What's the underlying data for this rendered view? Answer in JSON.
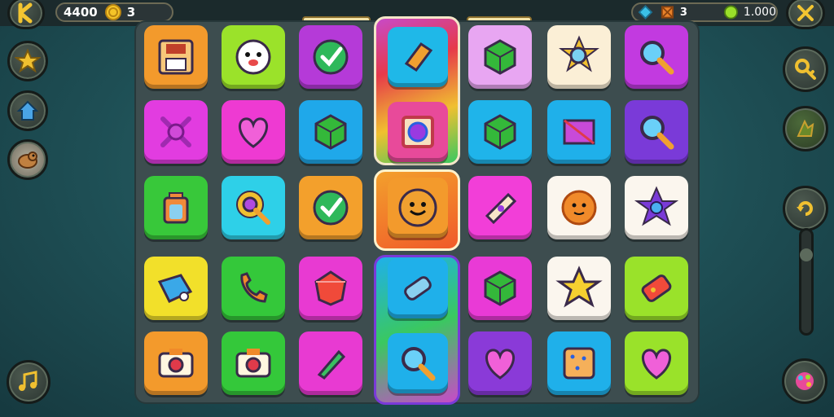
{
  "hud": {
    "back_icon": "back-icon",
    "moves_value": "4400",
    "coins_value": "3",
    "gems_value": "3",
    "gold_value": "1.000",
    "settings_icon": "crossed-tools-icon"
  },
  "left_panel": {
    "powerups": [
      {
        "name": "star-powerup",
        "icon": "star-icon",
        "color": "#f0c030"
      },
      {
        "name": "house-powerup",
        "icon": "house-icon",
        "color": "#4aa4e6"
      },
      {
        "name": "beast-powerup",
        "icon": "beast-icon",
        "color": "#c08040"
      }
    ],
    "music_icon": "music-note-icon"
  },
  "right_panel": {
    "buttons": [
      {
        "name": "key-button",
        "icon": "key-icon"
      },
      {
        "name": "hint-button",
        "icon": "hint-icon"
      },
      {
        "name": "refresh-button",
        "icon": "refresh-icon"
      }
    ],
    "slider_level": 0.2,
    "palette_icon": "palette-icon"
  },
  "board": {
    "rows": [
      [
        {
          "bg": "#f39a2c",
          "icon": "floppy-icon"
        },
        {
          "bg": "#9be22a",
          "icon": "face-icon"
        },
        {
          "bg": "#b53ad8",
          "icon": "check-icon"
        },
        {
          "bg": "#1fb8e8",
          "icon": "eraser-icon"
        },
        {
          "bg": "#e8a6f2",
          "icon": "cube-icon"
        },
        {
          "bg": "#fbefd6",
          "icon": "magnifier-star-icon"
        },
        {
          "bg": "#c23ae0",
          "icon": "magnifier-icon"
        }
      ],
      [
        {
          "bg": "#e23ce0",
          "icon": "target-icon"
        },
        {
          "bg": "#ee3ad2",
          "icon": "heart-icon"
        },
        {
          "bg": "#1fa8ea",
          "icon": "cube-icon"
        },
        {
          "bg": "#e84a9a",
          "icon": "gem-frame-icon"
        },
        {
          "bg": "#1fb4ea",
          "icon": "cube-icon"
        },
        {
          "bg": "#1fb0ea",
          "icon": "envelope-icon"
        },
        {
          "bg": "#7a3ad8",
          "icon": "magnifier-icon"
        }
      ],
      [
        {
          "bg": "#38c83a",
          "icon": "jar-icon"
        },
        {
          "bg": "#2ed0e8",
          "icon": "magnifier-sun-icon"
        },
        {
          "bg": "#f3a02c",
          "icon": "check-icon"
        },
        {
          "bg": "#f39a2c",
          "icon": "smiley-icon"
        },
        {
          "bg": "#f23ed8",
          "icon": "scroll-icon"
        },
        {
          "bg": "#fbf6ee",
          "icon": "sun-face-icon"
        },
        {
          "bg": "#fbf6ee",
          "icon": "star-ring-icon"
        }
      ],
      [
        {
          "bg": "#f2e02a",
          "icon": "tag-icon"
        },
        {
          "bg": "#34c83a",
          "icon": "phone-icon"
        },
        {
          "bg": "#e83ad2",
          "icon": "gem-icon"
        },
        {
          "bg": "#1fb0ea",
          "icon": "battery-icon"
        },
        {
          "bg": "#e93ad6",
          "icon": "cube-icon"
        },
        {
          "bg": "#fbf6ee",
          "icon": "star-icon"
        },
        {
          "bg": "#9ae22a",
          "icon": "phone-card-icon"
        }
      ],
      [
        {
          "bg": "#f39a2c",
          "icon": "camera-icon"
        },
        {
          "bg": "#34c83a",
          "icon": "camera-icon"
        },
        {
          "bg": "#e83ad2",
          "icon": "pencil-icon"
        },
        {
          "bg": "#1fb0ea",
          "icon": "magnifier-icon"
        },
        {
          "bg": "#8a3ad8",
          "icon": "heart-icon"
        },
        {
          "bg": "#1fb0ea",
          "icon": "cracker-icon"
        },
        {
          "bg": "#9ae22a",
          "icon": "heart-icon"
        }
      ]
    ]
  }
}
